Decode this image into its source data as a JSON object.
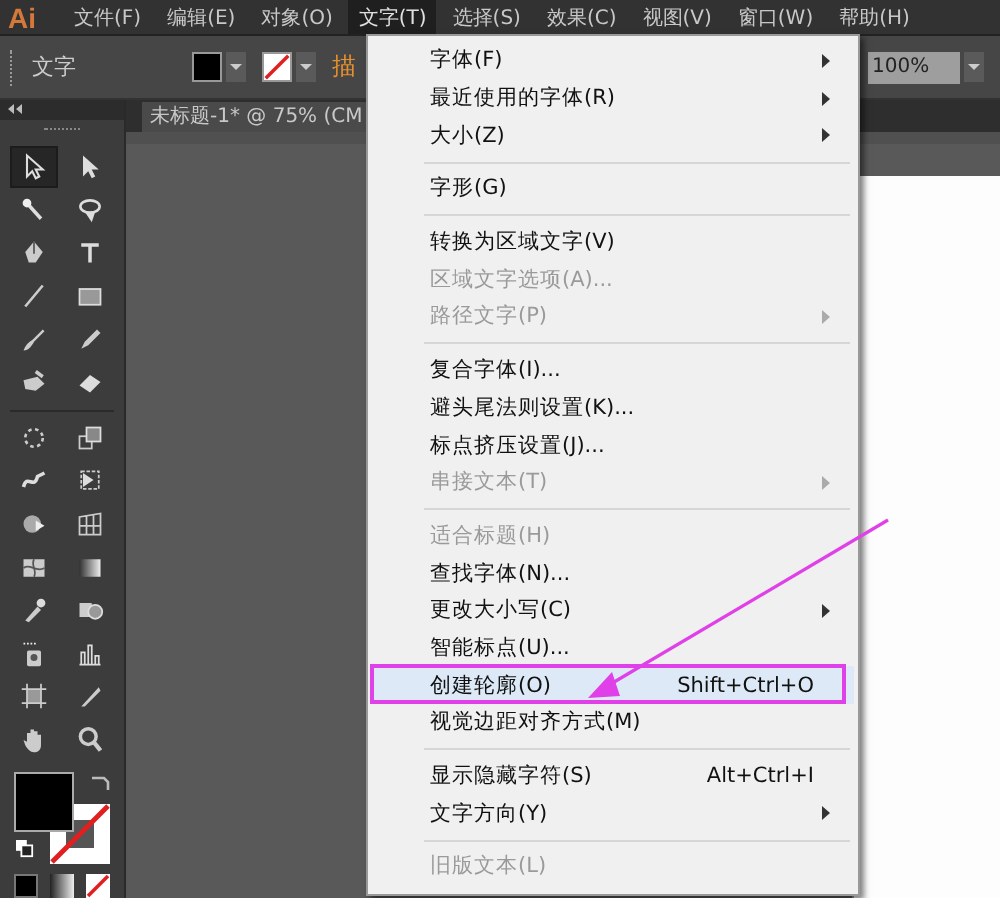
{
  "app_logo": "Ai",
  "menubar": [
    {
      "label": "文件(F)",
      "selected": false
    },
    {
      "label": "编辑(E)",
      "selected": false
    },
    {
      "label": "对象(O)",
      "selected": false
    },
    {
      "label": "文字(T)",
      "selected": true
    },
    {
      "label": "选择(S)",
      "selected": false
    },
    {
      "label": "效果(C)",
      "selected": false
    },
    {
      "label": "视图(V)",
      "selected": false
    },
    {
      "label": "窗口(W)",
      "selected": false
    },
    {
      "label": "帮助(H)",
      "selected": false
    }
  ],
  "control_bar": {
    "label": "文字",
    "stroke_label": "描",
    "zoom": "100%"
  },
  "document_tab": "未标题-1* @ 75% (CM",
  "tools": [
    {
      "selected": true
    },
    {
      "selected": false
    },
    {
      "selected": false
    },
    {
      "selected": false
    },
    {
      "selected": false
    },
    {
      "selected": false
    },
    {
      "selected": false
    },
    {
      "selected": false
    },
    {
      "selected": false
    },
    {
      "selected": false
    },
    {
      "selected": false
    },
    {
      "selected": false
    },
    {
      "selected": false
    },
    {
      "selected": false
    },
    {
      "selected": false
    },
    {
      "selected": false
    },
    {
      "selected": false
    },
    {
      "selected": false
    },
    {
      "selected": false
    },
    {
      "selected": false
    },
    {
      "selected": false
    },
    {
      "selected": false
    },
    {
      "selected": false
    },
    {
      "selected": false
    },
    {
      "selected": false
    },
    {
      "selected": false
    },
    {
      "selected": false
    },
    {
      "selected": false
    }
  ],
  "menu": {
    "items": [
      {
        "kind": "item",
        "label": "字体(F)",
        "disabled": false,
        "submenu": true,
        "selected": false
      },
      {
        "kind": "item",
        "label": "最近使用的字体(R)",
        "disabled": false,
        "submenu": true,
        "selected": false
      },
      {
        "kind": "item",
        "label": "大小(Z)",
        "disabled": false,
        "submenu": true,
        "selected": false
      },
      {
        "kind": "separator"
      },
      {
        "kind": "item",
        "label": "字形(G)",
        "disabled": false,
        "submenu": false,
        "selected": false
      },
      {
        "kind": "separator"
      },
      {
        "kind": "item",
        "label": "转换为区域文字(V)",
        "disabled": false,
        "submenu": false,
        "selected": false
      },
      {
        "kind": "item",
        "label": "区域文字选项(A)...",
        "disabled": true,
        "submenu": false,
        "selected": false
      },
      {
        "kind": "item",
        "label": "路径文字(P)",
        "disabled": true,
        "submenu": true,
        "selected": false
      },
      {
        "kind": "separator"
      },
      {
        "kind": "item",
        "label": "复合字体(I)...",
        "disabled": false,
        "submenu": false,
        "selected": false
      },
      {
        "kind": "item",
        "label": "避头尾法则设置(K)...",
        "disabled": false,
        "submenu": false,
        "selected": false
      },
      {
        "kind": "item",
        "label": "标点挤压设置(J)...",
        "disabled": false,
        "submenu": false,
        "selected": false
      },
      {
        "kind": "item",
        "label": "串接文本(T)",
        "disabled": true,
        "submenu": true,
        "selected": false
      },
      {
        "kind": "separator"
      },
      {
        "kind": "item",
        "label": "适合标题(H)",
        "disabled": true,
        "submenu": false,
        "selected": false
      },
      {
        "kind": "item",
        "label": "查找字体(N)...",
        "disabled": false,
        "submenu": false,
        "selected": false
      },
      {
        "kind": "item",
        "label": "更改大小写(C)",
        "disabled": false,
        "submenu": true,
        "selected": false
      },
      {
        "kind": "item",
        "label": "智能标点(U)...",
        "disabled": false,
        "submenu": false,
        "selected": false
      },
      {
        "kind": "item",
        "label": "创建轮廓(O)",
        "shortcut": "Shift+Ctrl+O",
        "disabled": false,
        "submenu": false,
        "selected": true
      },
      {
        "kind": "item",
        "label": "视觉边距对齐方式(M)",
        "disabled": false,
        "submenu": false,
        "selected": false
      },
      {
        "kind": "separator"
      },
      {
        "kind": "item",
        "label": "显示隐藏字符(S)",
        "shortcut": "Alt+Ctrl+I",
        "disabled": false,
        "submenu": false,
        "selected": false
      },
      {
        "kind": "item",
        "label": "文字方向(Y)",
        "disabled": false,
        "submenu": true,
        "selected": false
      },
      {
        "kind": "separator"
      },
      {
        "kind": "item",
        "label": "旧版文本(L)",
        "disabled": true,
        "submenu": false,
        "selected": false
      }
    ]
  }
}
